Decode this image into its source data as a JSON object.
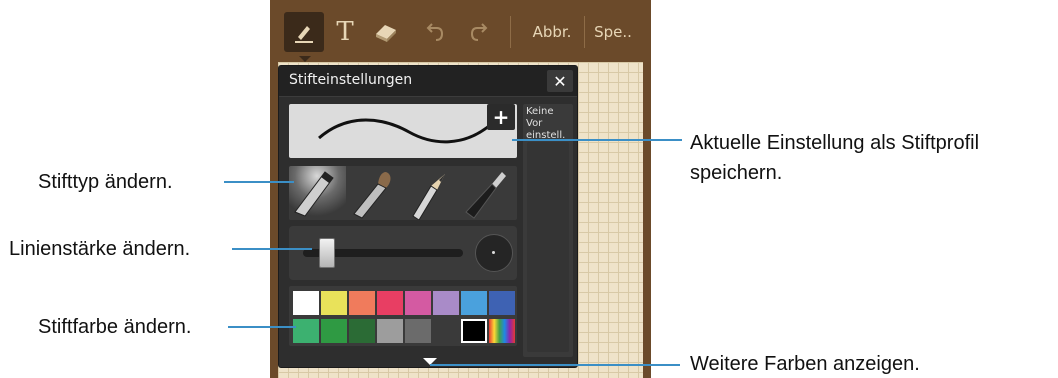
{
  "toolbar": {
    "items": [
      "pen-icon",
      "text-icon",
      "eraser-icon",
      "undo-icon",
      "redo-icon"
    ],
    "text_glyph": "T",
    "abbr_label": "Abbr.",
    "save_label": "Spe.."
  },
  "panel": {
    "title": "Stifteinstellungen",
    "close_glyph": "✕",
    "add_glyph": "+",
    "preset_text": "Keine Vor einstell."
  },
  "pen_types": [
    "marker-pen",
    "brush-pen",
    "pencil",
    "fountain-pen"
  ],
  "line_width": {
    "value": 0.1
  },
  "colors": {
    "row1": [
      "#ffffff",
      "#e9e25a",
      "#f07b5c",
      "#e83e63",
      "#d45aa2",
      "#a98bc8",
      "#4aa1dd",
      "#3e62b3"
    ],
    "row2": [
      "#3cb170",
      "#2f9a43",
      "#2b6b35",
      "#9d9d9d",
      "#6b6b6b",
      "#3a3a3a",
      "#000000",
      "rainbow"
    ],
    "selected": "#000000"
  },
  "callouts": {
    "pen_type": "Stifttyp ändern.",
    "line_width": "Linienstärke ändern.",
    "pen_color": "Stiftfarbe ändern.",
    "save_profile_1": "Aktuelle Einstellung als Stiftprofil",
    "save_profile_2": "speichern.",
    "more_colors": "Weitere Farben anzeigen."
  },
  "accent_color": "#3b8fc6"
}
